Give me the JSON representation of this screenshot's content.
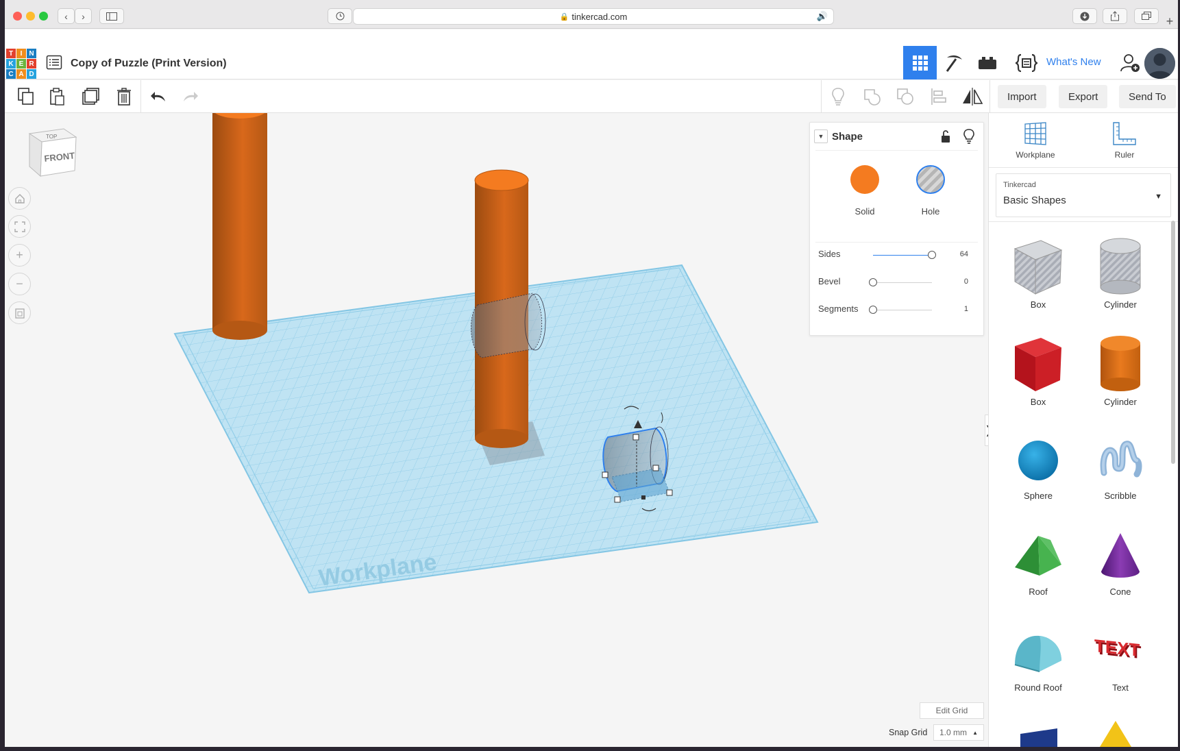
{
  "browser": {
    "url": "tinkercad.com"
  },
  "header": {
    "logo_letters": [
      "T",
      "I",
      "N",
      "K",
      "E",
      "R",
      "C",
      "A",
      "D"
    ],
    "design_title": "Copy of Puzzle (Print Version)",
    "whats_new": "What's New"
  },
  "toolbar": {
    "import_label": "Import",
    "export_label": "Export",
    "send_to_label": "Send To"
  },
  "viewcube": {
    "top": "TOP",
    "front": "FRONT"
  },
  "workplane_label": "Workplane",
  "inspector": {
    "title": "Shape",
    "solid_label": "Solid",
    "hole_label": "Hole",
    "props": [
      {
        "label": "Sides",
        "value": "64",
        "fraction": 1.0
      },
      {
        "label": "Bevel",
        "value": "0",
        "fraction": 0.0
      },
      {
        "label": "Segments",
        "value": "1",
        "fraction": 0.0
      }
    ]
  },
  "grid": {
    "edit_grid": "Edit Grid",
    "snap_label": "Snap Grid",
    "snap_value": "1.0 mm"
  },
  "right_panel": {
    "workplane": "Workplane",
    "ruler": "Ruler",
    "library_sub": "Tinkercad",
    "library_main": "Basic Shapes",
    "shapes": [
      "Box",
      "Cylinder",
      "Box",
      "Cylinder",
      "Sphere",
      "Scribble",
      "Roof",
      "Cone",
      "Round Roof",
      "Text"
    ]
  },
  "colors": {
    "accent": "#2f80ed",
    "solid_orange": "#f47b20",
    "workplane_blue": "#a8d8ee"
  }
}
